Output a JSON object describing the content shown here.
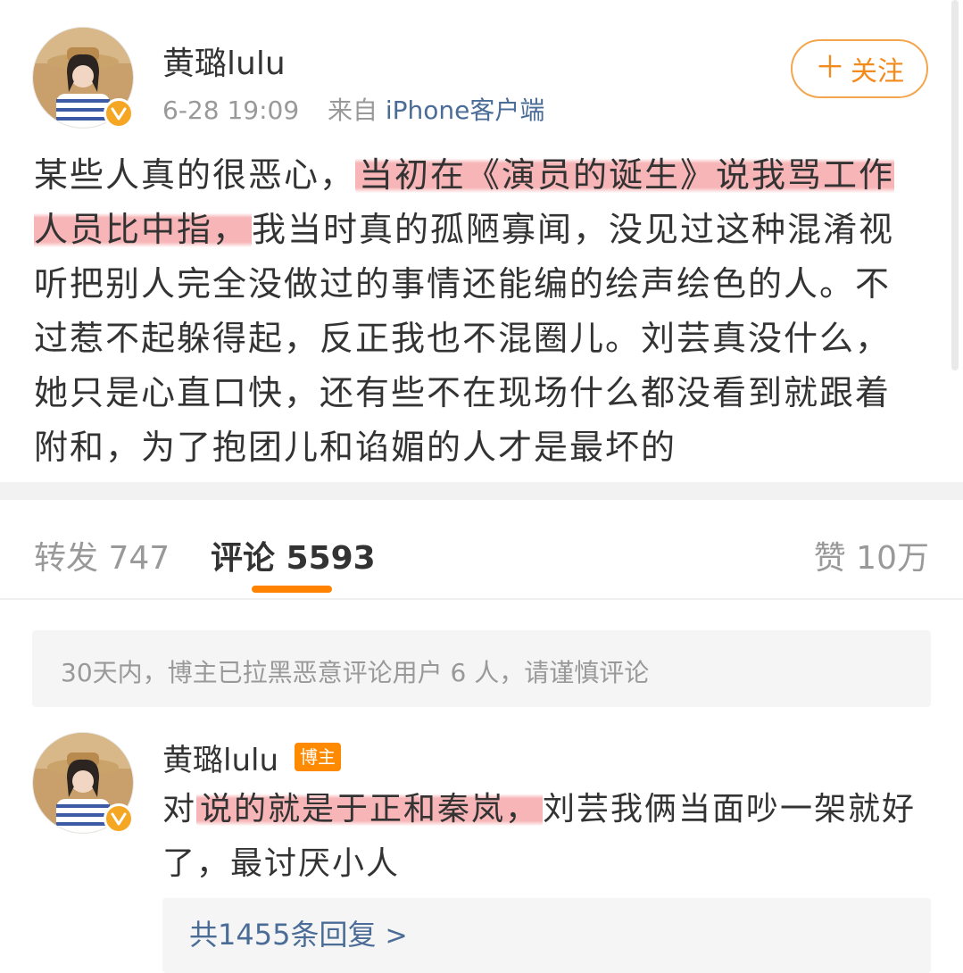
{
  "post": {
    "username": "黄璐lulu",
    "date": "6-28 19:09",
    "source_prefix": "来自",
    "source_app": "iPhone客户端",
    "follow_plus": "＋",
    "follow_label": "关注",
    "text": {
      "part1": "某些人真的很恶心，",
      "highlight1": "当初在《演员的诞生》说我骂工作人员比中指，",
      "part2": "我当时真的孤陋寡闻，没见过这种混淆视听把别人完全没做过的事情还能编的绘声绘色的人。不过惹不起躲得起，反正我也不混圈儿。刘芸真没什么，她只是心直口快，还有些不在现场什么都没看到就跟着附和，为了抱团儿和谄媚的人才是最坏的"
    }
  },
  "tabs": {
    "repost": "转发 747",
    "comments": "评论 5593",
    "likes": "赞 10万"
  },
  "notice": "30天内，博主已拉黑恶意评论用户 6 人，请谨慎评论",
  "comment": {
    "username": "黄璐lulu",
    "badge": "博主",
    "text_prefix": "对",
    "highlight": "说的就是于正和秦岚，",
    "text_rest": "刘芸我俩当面吵一架就好了，最讨厌小人",
    "replies_label": "共1455条回复",
    "replies_chevron": ">"
  },
  "colors": {
    "accent_orange": "#ff8200",
    "link_blue": "#4a6c96",
    "highlight_red": "#f2888c"
  }
}
